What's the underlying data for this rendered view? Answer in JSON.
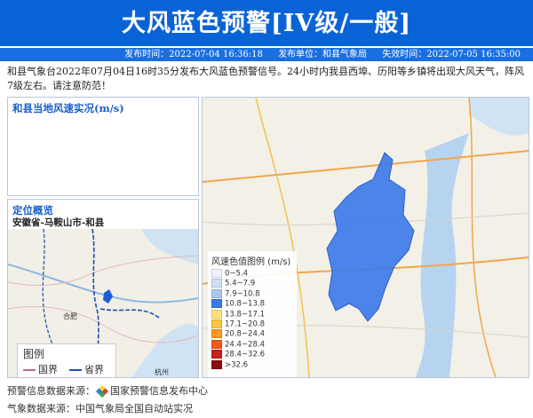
{
  "header": {
    "title": "大风蓝色预警[IV级/一般]",
    "issue_time": "发布时间：2022-07-04 16:36:18",
    "issuer": "发布单位：和县气象局",
    "expire_time": "失效时间：2022-07-05 16:35:00"
  },
  "description": "和县气象台2022年07月04日16时35分发布大风蓝色预警信号。24小时内我县西埠、历阳等乡镇将出现大风天气，阵风7级左右。请注意防范！",
  "wind_panel": {
    "title": "和县当地风速实况(m/s)"
  },
  "location_panel": {
    "title": "定位概览",
    "location": "安徽省-马鞍山市-和县",
    "map_labels": {
      "hefei": "合肥",
      "hangzhou": "杭州"
    },
    "legend": {
      "title": "图例",
      "items": [
        {
          "label": "国界",
          "color": "#c06a8a"
        },
        {
          "label": "省界",
          "color": "#1a4fb4"
        }
      ]
    }
  },
  "map_panel": {
    "scale_title": "风速色值图例 (m/s)",
    "scale": [
      {
        "label": "0~5.4",
        "color": "#eef4fb"
      },
      {
        "label": "5.4~7.9",
        "color": "#cfe0f5"
      },
      {
        "label": "7.9~10.8",
        "color": "#a9c8ee"
      },
      {
        "label": "10.8~13.8",
        "color": "#3a78e6"
      },
      {
        "label": "13.8~17.1",
        "color": "#ffe27a"
      },
      {
        "label": "17.1~20.8",
        "color": "#ffc640"
      },
      {
        "label": "20.8~24.4",
        "color": "#ff9a1f"
      },
      {
        "label": "24.4~28.4",
        "color": "#f05a1a"
      },
      {
        "label": "28.4~32.6",
        "color": "#c8201a"
      },
      {
        "label": ">32.6",
        "color": "#8b0d0d"
      }
    ],
    "accent_region_color": "#3f7be8"
  },
  "footer": {
    "warning_source": "预警信息数据来源：",
    "warning_source_org": "国家预警信息发布中心",
    "weather_source": "气象数据来源：中国气象局全国自动站实况"
  },
  "colors": {
    "header": "#0a63d6",
    "meta_bar": "#1a6fe0",
    "panel_title": "#1a5fc8"
  }
}
